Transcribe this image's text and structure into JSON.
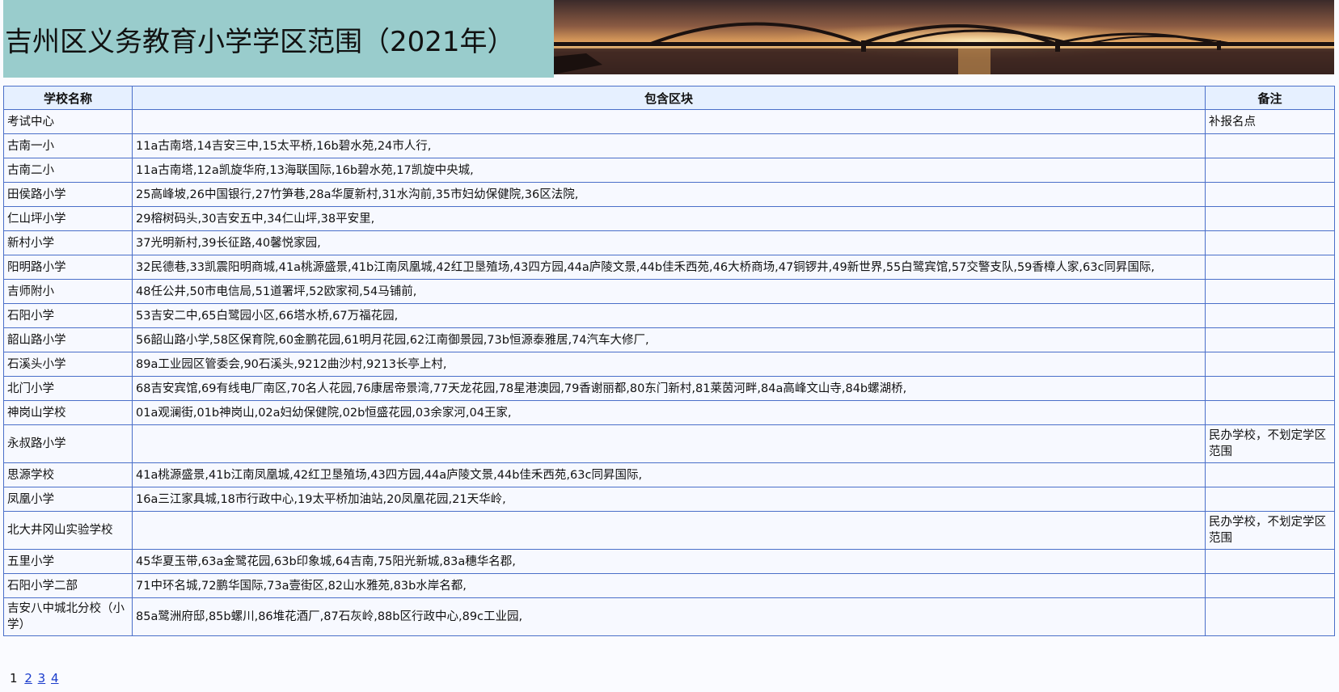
{
  "page": {
    "title": "吉州区义务教育小学学区范围（2021年）"
  },
  "table": {
    "headers": [
      "学校名称",
      "包含区块",
      "备注"
    ],
    "rows": [
      {
        "school": "考试中心",
        "blocks": "",
        "note": "补报名点"
      },
      {
        "school": "古南一小",
        "blocks": "11a古南塔,14吉安三中,15太平桥,16b碧水苑,24市人行,",
        "note": ""
      },
      {
        "school": "古南二小",
        "blocks": "11a古南塔,12a凯旋华府,13海联国际,16b碧水苑,17凯旋中央城,",
        "note": ""
      },
      {
        "school": "田侯路小学",
        "blocks": "25高峰坡,26中国银行,27竹笋巷,28a华厦新村,31水沟前,35市妇幼保健院,36区法院,",
        "note": ""
      },
      {
        "school": "仁山坪小学",
        "blocks": "29榕树码头,30吉安五中,34仁山坪,38平安里,",
        "note": ""
      },
      {
        "school": "新村小学",
        "blocks": "37光明新村,39长征路,40馨悦家园,",
        "note": ""
      },
      {
        "school": "阳明路小学",
        "blocks": "32民德巷,33凯震阳明商城,41a桃源盛景,41b江南凤凰城,42红卫垦殖场,43四方园,44a庐陵文景,44b佳禾西苑,46大桥商场,47铜锣井,49新世界,55白鹭宾馆,57交警支队,59香樟人家,63c同昇国际,",
        "note": ""
      },
      {
        "school": "吉师附小",
        "blocks": "48任公井,50市电信局,51道署坪,52欧家祠,54马铺前,",
        "note": ""
      },
      {
        "school": "石阳小学",
        "blocks": "53吉安二中,65白鹭园小区,66塔水桥,67万福花园,",
        "note": ""
      },
      {
        "school": "韶山路小学",
        "blocks": "56韶山路小学,58区保育院,60金鹏花园,61明月花园,62江南御景园,73b恒源泰雅居,74汽车大修厂,",
        "note": ""
      },
      {
        "school": "石溪头小学",
        "blocks": "89a工业园区管委会,90石溪头,9212曲沙村,9213长亭上村,",
        "note": ""
      },
      {
        "school": "北门小学",
        "blocks": "68吉安宾馆,69有线电厂南区,70名人花园,76康居帝景湾,77天龙花园,78星港澳园,79香谢丽都,80东门新村,81莱茵河畔,84a高峰文山寺,84b螺湖桥,",
        "note": ""
      },
      {
        "school": "神岗山学校",
        "blocks": "01a观澜街,01b神岗山,02a妇幼保健院,02b恒盛花园,03余家河,04王家,",
        "note": ""
      },
      {
        "school": "永叔路小学",
        "blocks": "",
        "note": "民办学校，不划定学区范围"
      },
      {
        "school": "思源学校",
        "blocks": "41a桃源盛景,41b江南凤凰城,42红卫垦殖场,43四方园,44a庐陵文景,44b佳禾西苑,63c同昇国际,",
        "note": ""
      },
      {
        "school": "凤凰小学",
        "blocks": "16a三江家具城,18市行政中心,19太平桥加油站,20凤凰花园,21天华岭,",
        "note": ""
      },
      {
        "school": "北大井冈山实验学校",
        "blocks": "",
        "note": "民办学校，不划定学区范围"
      },
      {
        "school": "五里小学",
        "blocks": "45华夏玉带,63a金鹭花园,63b印象城,64吉南,75阳光新城,83a穗华名郡,",
        "note": ""
      },
      {
        "school": "石阳小学二部",
        "blocks": "71中环名城,72鹏华国际,73a壹街区,82山水雅苑,83b水岸名都,",
        "note": ""
      },
      {
        "school": "吉安八中城北分校（小学）",
        "blocks": "85a鹭洲府邸,85b螺川,86堆花酒厂,87石灰岭,88b区行政中心,89c工业园,",
        "note": ""
      }
    ]
  },
  "pager": {
    "current": "1",
    "links": [
      "2",
      "3",
      "4"
    ]
  },
  "colors": {
    "title_bg": "#99cccc",
    "header_bg": "#e6f0ff",
    "border": "#4a6fc9",
    "link": "#1a3ccc"
  }
}
